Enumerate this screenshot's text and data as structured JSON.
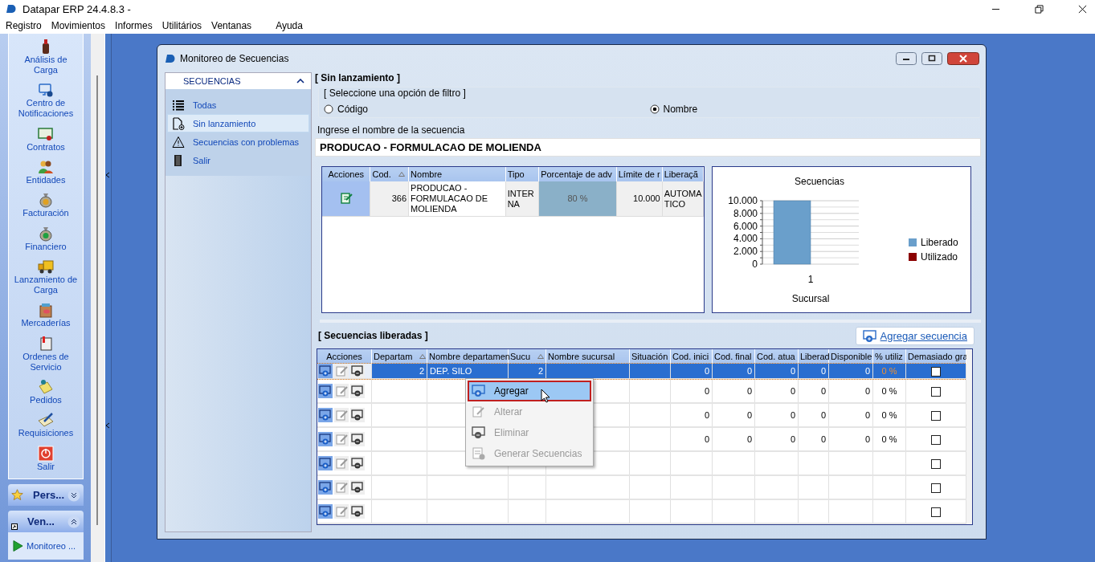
{
  "app": {
    "title": "Datapar ERP 24.4.8.3 -"
  },
  "menu": [
    "Registro",
    "Movimientos",
    "Informes",
    "Utilitários",
    "Ventanas",
    "Ayuda"
  ],
  "modules": [
    {
      "label": "Análisis de Carga"
    },
    {
      "label": "Centro de Notificaciones"
    },
    {
      "label": "Contratos"
    },
    {
      "label": "Entidades"
    },
    {
      "label": "Facturación"
    },
    {
      "label": "Financiero"
    },
    {
      "label": "Lanzamiento de Carga"
    },
    {
      "label": "Mercaderías"
    },
    {
      "label": "Ordenes de Servicio"
    },
    {
      "label": "Pedidos"
    },
    {
      "label": "Requisiciones"
    },
    {
      "label": "Salir"
    }
  ],
  "groups": [
    {
      "label": "Pers...",
      "expanded": false
    },
    {
      "label": "Ven...",
      "expanded": true,
      "items": [
        {
          "label": "Monitoreo ..."
        }
      ]
    }
  ],
  "window": {
    "title": "Monitoreo de Secuencias"
  },
  "side_panel": {
    "header": "SECUENCIAS",
    "expanded": true,
    "items": [
      {
        "label": "Todas",
        "selected": false
      },
      {
        "label": "Sin lanzamiento",
        "selected": true
      },
      {
        "label": "Secuencias con problemas",
        "selected": false
      },
      {
        "label": "Salir",
        "selected": false
      }
    ]
  },
  "filter": {
    "heading": "[ Sin lanzamiento ]",
    "group_label": "[ Seleccione una opción de filtro ]",
    "options": [
      {
        "label": "Código",
        "selected": false
      },
      {
        "label": "Nombre",
        "selected": true
      }
    ],
    "field_label": "Ingrese el nombre de la secuencia",
    "field_value": "PRODUCAO - FORMULACAO DE MOLIENDA"
  },
  "top_table": {
    "columns": [
      {
        "label": "Acciones",
        "sorted": false
      },
      {
        "label": "Cod.",
        "sorted": true
      },
      {
        "label": "Nombre",
        "sorted": false
      },
      {
        "label": "Tipo",
        "sorted": false
      },
      {
        "label": "Porcentaje de adv",
        "sorted": false
      },
      {
        "label": "Límite de r",
        "sorted": false
      },
      {
        "label": "Liberaçã",
        "sorted": false
      }
    ],
    "rows": [
      {
        "cells": [
          null,
          "366",
          "PRODUCAO - FORMULACAO DE MOLIENDA",
          "INTER NA",
          "80 %",
          "10.000",
          "AUTOMA TICO"
        ]
      }
    ]
  },
  "chart": {
    "chart_data": {
      "type": "bar",
      "title": "Secuencias",
      "xlabel": "Sucursal",
      "categories": [
        "1"
      ],
      "grid": true,
      "series": [
        {
          "name": "Liberado",
          "color": "#6a9fcb",
          "values": [
            10000
          ]
        },
        {
          "name": "Utilizado",
          "color": "#8b0000",
          "values": [
            0
          ]
        }
      ],
      "ylim": [
        0,
        10000
      ],
      "yticks": [
        {
          "value": 0,
          "label": "0"
        },
        {
          "value": 2000,
          "label": "2.000"
        },
        {
          "value": 4000,
          "label": "4.000"
        },
        {
          "value": 6000,
          "label": "6.000"
        },
        {
          "value": 8000,
          "label": "8.000"
        },
        {
          "value": 10000,
          "label": "10.000"
        }
      ]
    }
  },
  "released": {
    "heading": "[ Secuencias liberadas ]",
    "add_button": "Agregar secuencia",
    "columns": [
      {
        "label": "Acciones",
        "kind": "actions",
        "sorted": false
      },
      {
        "label": "Departam",
        "kind": "number",
        "sorted": true
      },
      {
        "label": "Nombre departamen",
        "kind": "text",
        "sorted": false
      },
      {
        "label": "Sucu",
        "kind": "number",
        "sorted": true
      },
      {
        "label": "Nombre sucursal",
        "kind": "text",
        "sorted": false
      },
      {
        "label": "Situación",
        "kind": "text",
        "sorted": false
      },
      {
        "label": "Cod. inici",
        "kind": "number",
        "sorted": false
      },
      {
        "label": "Cod. final",
        "kind": "number",
        "sorted": false
      },
      {
        "label": "Cod. atua",
        "kind": "number",
        "sorted": false
      },
      {
        "label": "Liberad",
        "kind": "number",
        "sorted": false
      },
      {
        "label": "Disponible",
        "kind": "number",
        "sorted": false
      },
      {
        "label": "% utiliz",
        "kind": "percent",
        "sorted": false
      },
      {
        "label": "Demasiado gra",
        "kind": "check",
        "sorted": false
      }
    ],
    "rows": [
      {
        "selected": true,
        "checked": false,
        "cells": [
          null,
          "2",
          "DEP. SILO",
          "2",
          null,
          null,
          "0",
          "0",
          "0",
          "0",
          "0",
          "0 %",
          null
        ]
      },
      {
        "selected": false,
        "checked": false,
        "cells": [
          null,
          null,
          null,
          null,
          null,
          null,
          "0",
          "0",
          "0",
          "0",
          "0",
          "0 %",
          null
        ]
      },
      {
        "selected": false,
        "checked": false,
        "cells": [
          null,
          null,
          null,
          null,
          null,
          null,
          "0",
          "0",
          "0",
          "0",
          "0",
          "0 %",
          null
        ]
      },
      {
        "selected": false,
        "checked": false,
        "cells": [
          null,
          null,
          null,
          null,
          null,
          null,
          "0",
          "0",
          "0",
          "0",
          "0",
          "0 %",
          null
        ]
      },
      {
        "selected": false,
        "checked": false
      },
      {
        "selected": false,
        "checked": false
      },
      {
        "selected": false,
        "checked": false
      }
    ]
  },
  "context_menu": {
    "items": [
      {
        "label": "Agregar",
        "disabled": false,
        "selected": true
      },
      {
        "label": "Alterar",
        "disabled": true,
        "selected": false
      },
      {
        "label": "Eliminar",
        "disabled": true,
        "selected": false
      },
      {
        "label": "Generar Secuencias",
        "disabled": true,
        "selected": false
      }
    ]
  }
}
